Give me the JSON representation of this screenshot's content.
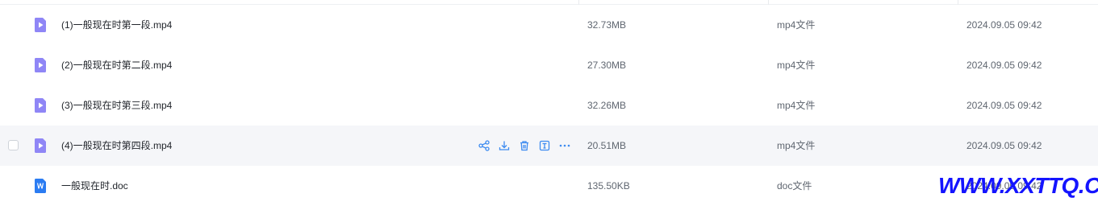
{
  "files": [
    {
      "name": "(1)一般现在时第一段.mp4",
      "size": "32.73MB",
      "type": "mp4文件",
      "date": "2024.09.05 09:42",
      "icon": "video-file-icon"
    },
    {
      "name": "(2)一般现在时第二段.mp4",
      "size": "27.30MB",
      "type": "mp4文件",
      "date": "2024.09.05 09:42",
      "icon": "video-file-icon"
    },
    {
      "name": "(3)一般现在时第三段.mp4",
      "size": "32.26MB",
      "type": "mp4文件",
      "date": "2024.09.05 09:42",
      "icon": "video-file-icon"
    },
    {
      "name": "(4)一般现在时第四段.mp4",
      "size": "20.51MB",
      "type": "mp4文件",
      "date": "2024.09.05 09:42",
      "icon": "video-file-icon"
    },
    {
      "name": "一般现在时.doc",
      "size": "135.50KB",
      "type": "doc文件",
      "date": "2024.09.05 09:42",
      "icon": "word-file-icon"
    }
  ],
  "hover_row_actions": [
    "share-icon",
    "download-icon",
    "delete-icon",
    "rename-icon",
    "more-icon"
  ],
  "watermark": "WWW.XXTTQ.COM",
  "colors": {
    "video_icon": "#8f86f6",
    "word_icon": "#2b7cf2",
    "action_icon": "#3d8bf0",
    "hover_row": "#f5f6f9",
    "watermark": "#1414ff"
  }
}
